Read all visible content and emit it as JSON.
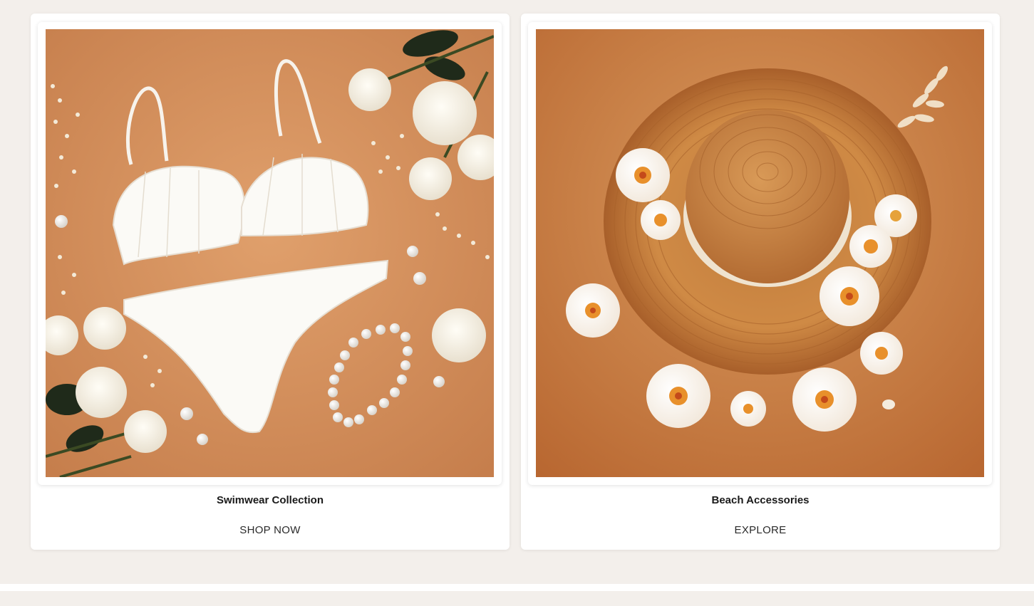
{
  "colors": {
    "page_background": "#f3efeb",
    "card_background": "#ffffff",
    "photo_background_left": "#cf8a57",
    "photo_background_right": "#c27a44"
  },
  "cards": [
    {
      "image_subject": "white swimsuit with roses, pearls and baby's breath on orange background",
      "title": "Swimwear Collection",
      "cta": "SHOP NOW"
    },
    {
      "image_subject": "straw sun hat with plumeria flowers on orange background",
      "title": "Beach Accessories",
      "cta": "EXPLORE"
    }
  ]
}
